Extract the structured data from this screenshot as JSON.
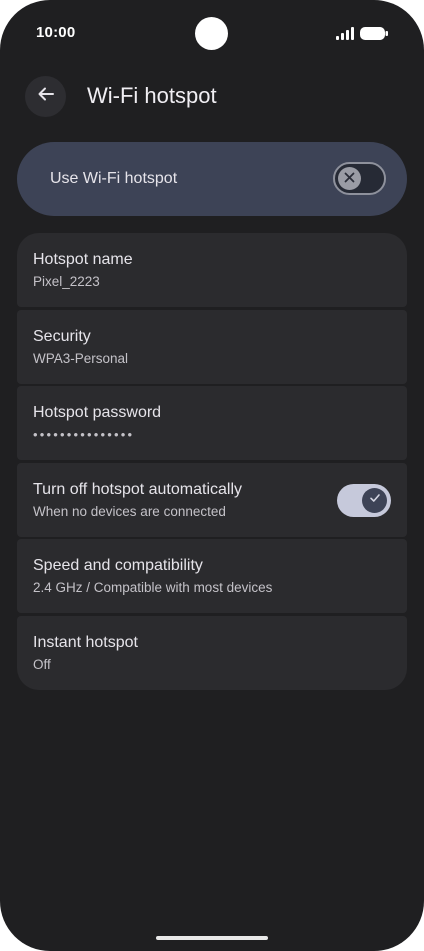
{
  "status_bar": {
    "time": "10:00",
    "signal_icon": "signal-bars-icon",
    "battery_icon": "battery-full-icon"
  },
  "app_bar": {
    "back_icon": "arrow-back-icon",
    "title": "Wi-Fi hotspot"
  },
  "main_toggle": {
    "label": "Use Wi-Fi hotspot",
    "enabled": false,
    "thumb_icon": "close-icon"
  },
  "settings": [
    {
      "title": "Hotspot name",
      "subtitle": "Pixel_2223"
    },
    {
      "title": "Security",
      "subtitle": "WPA3-Personal"
    },
    {
      "title": "Hotspot password",
      "subtitle": "•••••••••••••••"
    },
    {
      "title": "Turn off hotspot automatically",
      "subtitle": "When no devices are connected",
      "toggle": true,
      "toggle_icon": "check-icon"
    },
    {
      "title": "Speed and compatibility",
      "subtitle": "2.4 GHz / Compatible with most devices"
    },
    {
      "title": "Instant hotspot",
      "subtitle": "Off"
    }
  ],
  "colors": {
    "background": "#1f1f21",
    "card": "#2b2b2e",
    "toggle_card": "#3d4356",
    "switch_on_track": "#c6c9db"
  }
}
